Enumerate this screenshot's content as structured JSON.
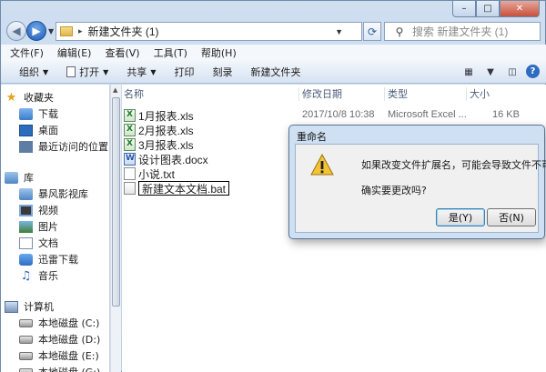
{
  "window": {
    "caption": {
      "minimize": "–",
      "maximize": "□",
      "close": "✕"
    }
  },
  "address_bar": {
    "path_separator": "▸",
    "path": "新建文件夹 (1)",
    "search_placeholder": "搜索 新建文件夹 (1)"
  },
  "menu": [
    "文件(F)",
    "编辑(E)",
    "查看(V)",
    "工具(T)",
    "帮助(H)"
  ],
  "toolbar": {
    "organize": "组织",
    "open": "打开",
    "share": "共享",
    "print": "打印",
    "burn": "刻录",
    "new_folder": "新建文件夹"
  },
  "nav_pane": {
    "favorites": {
      "label": "收藏夹",
      "items": [
        "下载",
        "桌面",
        "最近访问的位置"
      ]
    },
    "libraries": {
      "label": "库",
      "items": [
        "暴风影视库",
        "视频",
        "图片",
        "文档",
        "迅雷下载",
        "音乐"
      ]
    },
    "computer": {
      "label": "计算机",
      "drives": [
        "本地磁盘 (C:)",
        "本地磁盘 (D:)",
        "本地磁盘 (E:)",
        "本地磁盘 (G:)"
      ]
    }
  },
  "file_list": {
    "columns": {
      "name": "名称",
      "modified": "修改日期",
      "type": "类型",
      "size": "大小"
    },
    "files": [
      {
        "name": "1月报表.xls",
        "modified": "2017/10/8 10:38",
        "type": "Microsoft Excel ...",
        "size": "16 KB",
        "icon": "excel-file-icon"
      },
      {
        "name": "2月报表.xls",
        "icon": "excel-file-icon"
      },
      {
        "name": "3月报表.xls",
        "icon": "excel-file-icon"
      },
      {
        "name": "设计图表.docx",
        "icon": "word-file-icon"
      },
      {
        "name": "小说.txt",
        "icon": "text-file-icon"
      }
    ],
    "rename_value": "新建文本文档.bat"
  },
  "dialog": {
    "title": "重命名",
    "message": "如果改变文件扩展名，可能会导致文件不可用。",
    "question": "确实要更改吗?",
    "yes": "是(Y)",
    "no": "否(N)",
    "icon": "warning-icon"
  }
}
